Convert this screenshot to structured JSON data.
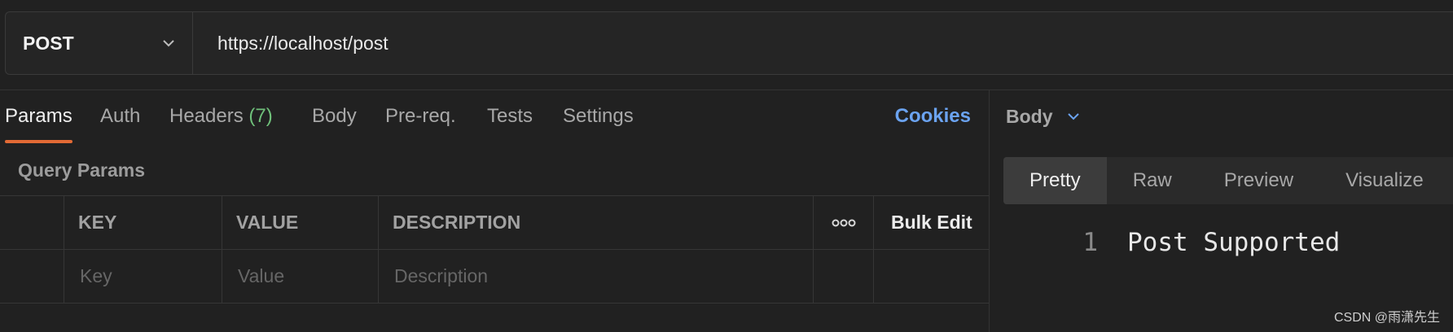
{
  "request": {
    "method": "POST",
    "url": "https://localhost/post"
  },
  "tabs": [
    {
      "label": "Params",
      "active": true
    },
    {
      "label": "Auth"
    },
    {
      "label": "Headers",
      "count": "(7)"
    },
    {
      "label": "Body"
    },
    {
      "label": "Pre-req."
    },
    {
      "label": "Tests"
    },
    {
      "label": "Settings"
    }
  ],
  "cookies_label": "Cookies",
  "query_params": {
    "title": "Query Params",
    "columns": [
      "KEY",
      "VALUE",
      "DESCRIPTION"
    ],
    "bulk_edit_label": "Bulk Edit",
    "placeholders": {
      "key": "Key",
      "value": "Value",
      "description": "Description"
    }
  },
  "response": {
    "section_label": "Body",
    "view_tabs": [
      {
        "label": "Pretty",
        "active": true
      },
      {
        "label": "Raw"
      },
      {
        "label": "Preview"
      },
      {
        "label": "Visualize"
      }
    ],
    "lines": [
      {
        "number": "1",
        "text": "Post Supported"
      }
    ]
  },
  "watermark": "CSDN @雨潇先生",
  "colors": {
    "accent_underline": "#e26a35",
    "cookies_link": "#6ba3f0",
    "header_count": "#6fc07a"
  },
  "icons": [
    "chevron-down-icon",
    "more-options-icon"
  ]
}
